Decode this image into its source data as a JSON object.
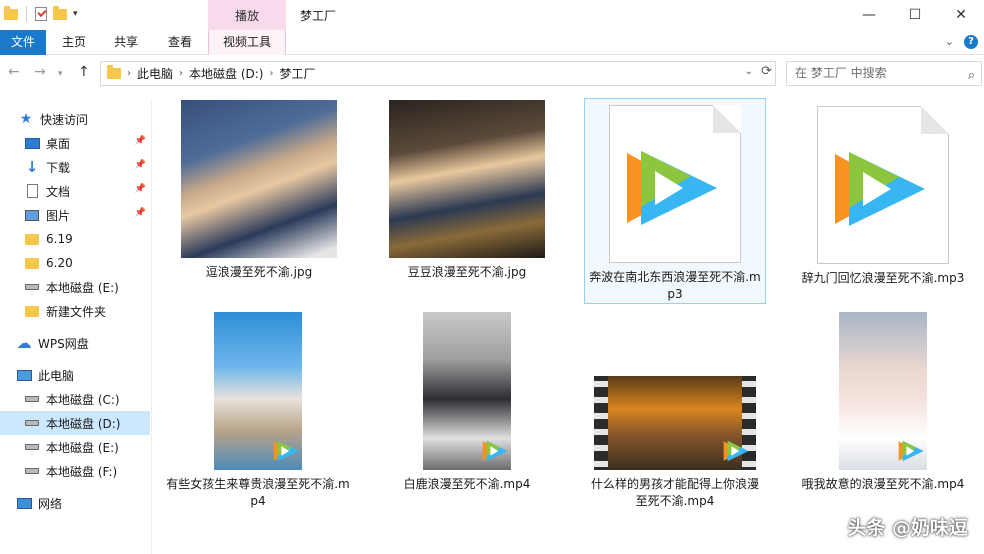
{
  "window": {
    "title": "梦工厂",
    "context_tab": "播放",
    "minimize": "—",
    "maximize": "☐",
    "close": "✕"
  },
  "ribbon": {
    "tabs": [
      "文件",
      "主页",
      "共享",
      "查看",
      "视频工具"
    ],
    "collapse": "⌄",
    "help": "?"
  },
  "address": {
    "back": "←",
    "forward": "→",
    "up": "↑",
    "crumbs": [
      "此电脑",
      "本地磁盘 (D:)",
      "梦工厂"
    ],
    "search_placeholder": "在 梦工厂 中搜索"
  },
  "sidebar": {
    "items": [
      {
        "label": "快速访问",
        "icon": "star-icon"
      },
      {
        "label": "桌面",
        "icon": "desktop-icon",
        "pinned": true
      },
      {
        "label": "下载",
        "icon": "download-icon",
        "pinned": true
      },
      {
        "label": "文档",
        "icon": "document-icon",
        "pinned": true
      },
      {
        "label": "图片",
        "icon": "pictures-icon",
        "pinned": true
      },
      {
        "label": "6.19",
        "icon": "folder-icon"
      },
      {
        "label": "6.20",
        "icon": "folder-icon"
      },
      {
        "label": "本地磁盘 (E:)",
        "icon": "drive-icon"
      },
      {
        "label": "新建文件夹",
        "icon": "folder-icon"
      },
      {
        "label": "WPS网盘",
        "icon": "cloud-icon"
      },
      {
        "label": "此电脑",
        "icon": "computer-icon"
      },
      {
        "label": "本地磁盘 (C:)",
        "icon": "drive-icon"
      },
      {
        "label": "本地磁盘 (D:)",
        "icon": "drive-icon",
        "selected": true
      },
      {
        "label": "本地磁盘 (E:)",
        "icon": "drive-icon"
      },
      {
        "label": "本地磁盘 (F:)",
        "icon": "drive-icon"
      },
      {
        "label": "网络",
        "icon": "network-icon"
      }
    ]
  },
  "files": [
    {
      "name": "逗浪漫至死不渝.jpg",
      "type": "image"
    },
    {
      "name": "豆豆浪漫至死不渝.jpg",
      "type": "image"
    },
    {
      "name": "奔波在南北东西浪漫至死不渝.mp3",
      "type": "audio",
      "selected": true
    },
    {
      "name": "辞九门回忆浪漫至死不渝.mp3",
      "type": "audio"
    },
    {
      "name": "有些女孩生来尊贵浪漫至死不渝.mp4",
      "type": "video"
    },
    {
      "name": "白鹿浪漫至死不渝.mp4",
      "type": "video"
    },
    {
      "name": "什么样的男孩才能配得上你浪漫至死不渝.mp4",
      "type": "video"
    },
    {
      "name": "哦我故意的浪漫至死不渝.mp4",
      "type": "video"
    }
  ],
  "watermark": "头条 @奶味逗",
  "colors": {
    "accent": "#1979ca",
    "context_tab": "#f9d9ec",
    "selected_nav": "#cce8ff"
  }
}
